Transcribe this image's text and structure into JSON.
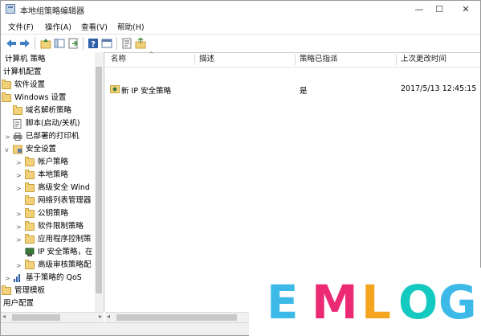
{
  "window": {
    "title": "本地组策略编辑器",
    "controls": {
      "minimize": "—",
      "maximize": "☐",
      "close": "✕"
    }
  },
  "menu": [
    "文件(F)",
    "操作(A)",
    "查看(V)",
    "帮助(H)"
  ],
  "toolbar": [
    "back-arrow-icon",
    "forward-arrow-icon",
    "up-folder-icon",
    "show-hide-tree-icon",
    "export-list-icon",
    "help-icon",
    "properties-icon",
    "policy-icon",
    "up-level-icon"
  ],
  "tree": [
    {
      "label": "计算机 策略",
      "twisty": "",
      "icon": "none"
    },
    {
      "label": "计算机配置",
      "twisty": "",
      "icon": "none"
    },
    {
      "label": "软件设置",
      "twisty": "",
      "icon": "folder"
    },
    {
      "label": "Windows 设置",
      "twisty": "",
      "icon": "folder"
    },
    {
      "label": "域名解析策略",
      "twisty": "",
      "icon": "folder"
    },
    {
      "label": "脚本(启动/关机)",
      "twisty": "",
      "icon": "script"
    },
    {
      "label": "已部署的打印机",
      "twisty": ">",
      "icon": "printer"
    },
    {
      "label": "安全设置",
      "twisty": "v",
      "icon": "security"
    },
    {
      "label": "帐户策略",
      "twisty": ">",
      "icon": "folder"
    },
    {
      "label": "本地策略",
      "twisty": ">",
      "icon": "folder"
    },
    {
      "label": "高级安全 Wind",
      "twisty": ">",
      "icon": "folder"
    },
    {
      "label": "网络列表管理器",
      "twisty": "",
      "icon": "folder"
    },
    {
      "label": "公钥策略",
      "twisty": ">",
      "icon": "folder"
    },
    {
      "label": "软件限制策略",
      "twisty": ">",
      "icon": "folder"
    },
    {
      "label": "应用程序控制策",
      "twisty": ">",
      "icon": "folder"
    },
    {
      "label": "IP 安全策略，在",
      "twisty": "",
      "icon": "ipsec"
    },
    {
      "label": "高级审核策略配",
      "twisty": ">",
      "icon": "folder"
    },
    {
      "label": "基于策略的 QoS",
      "twisty": ">",
      "icon": "qos"
    },
    {
      "label": "管理模板",
      "twisty": "",
      "icon": "folder"
    },
    {
      "label": "用户配置",
      "twisty": "",
      "icon": "none"
    }
  ],
  "list": {
    "columns": [
      "名称",
      "描述",
      "策略已指派",
      "上次更改时间"
    ],
    "rows": [
      {
        "name": "新 IP 安全策略",
        "description": "",
        "assigned": "是",
        "modified": "2017/5/13 12:45:15"
      }
    ]
  },
  "watermark": {
    "letters": [
      "E",
      "M",
      "L",
      "O",
      "G"
    ],
    "colors": {
      "E": "#3db9e8",
      "M": "#ec2a73",
      "L": "#f5a41f",
      "O": "#14c9c0",
      "G": "#3db9e8"
    }
  }
}
